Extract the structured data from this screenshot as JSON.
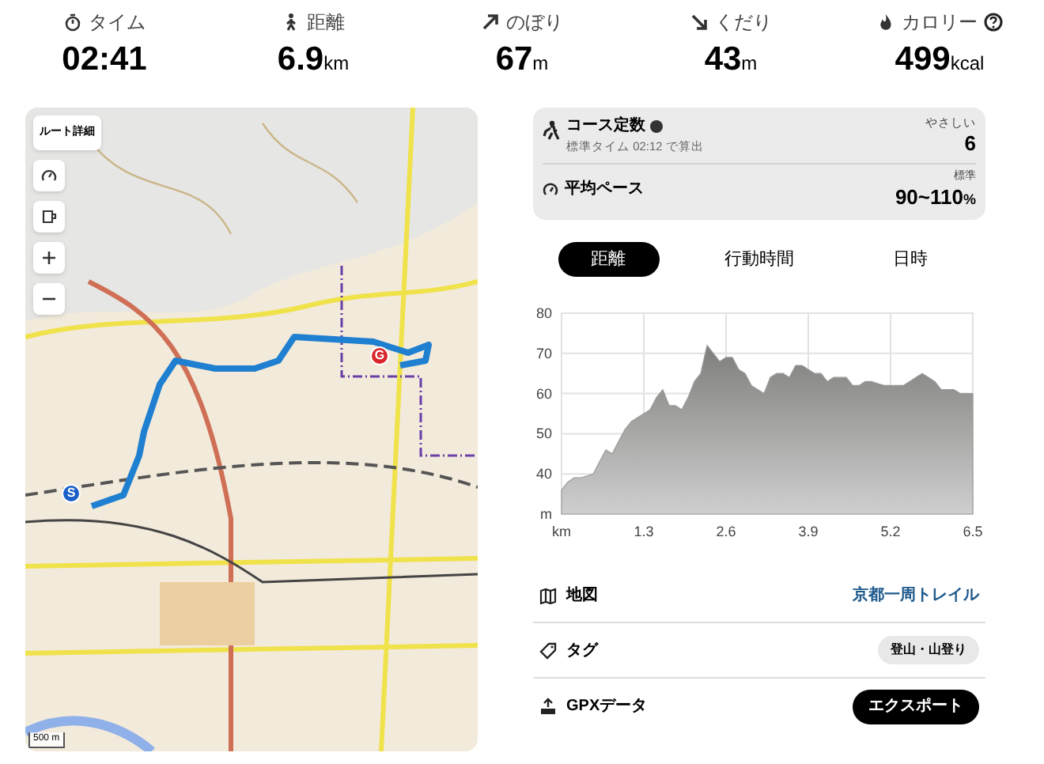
{
  "stats": [
    {
      "kind": "timer",
      "label": "タイム",
      "value": "02:41",
      "help": false
    },
    {
      "kind": "walk",
      "label": "距離",
      "value": "6.9",
      "unit": "km",
      "help": false
    },
    {
      "kind": "up",
      "label": "のぼり",
      "value": "67",
      "unit": "m",
      "help": false
    },
    {
      "kind": "down",
      "label": "くだり",
      "value": "43",
      "unit": "m",
      "help": false
    },
    {
      "kind": "fire",
      "label": "カロリー",
      "value": "499",
      "unit": "kcal",
      "help": true
    }
  ],
  "map": {
    "kind": "picture",
    "route_button": "ルート詳細",
    "scale": "500 m",
    "markers": [
      {
        "label": "S",
        "color": "#1a5fc8"
      },
      {
        "label": "G",
        "color": "#d9262b"
      }
    ]
  },
  "course": {
    "label": "コース定数",
    "sub": "標準タイム 02:12 で算出",
    "rating": "やさしい",
    "value": "6"
  },
  "pace": {
    "label": "平均ペース",
    "rating": "標準",
    "value": "90~110",
    "unit": "%"
  },
  "tabs": [
    {
      "label": "距離",
      "selected": true
    },
    {
      "label": "行動時間",
      "selected": false
    },
    {
      "label": "日時",
      "selected": false
    }
  ],
  "chart_data": {
    "type": "area",
    "grid": true,
    "ylim": [
      30,
      80
    ],
    "xlim": [
      0,
      6.5
    ],
    "yticks": [
      {
        "value": 30,
        "label": "m"
      },
      40,
      50,
      60,
      70,
      80
    ],
    "xticks": [
      {
        "value": 0,
        "label": "km"
      },
      1.3,
      2.6,
      3.9,
      5.2,
      6.5
    ],
    "x": [
      0,
      0.1,
      0.2,
      0.3,
      0.4,
      0.5,
      0.6,
      0.7,
      0.8,
      0.9,
      1,
      1.1,
      1.2,
      1.3,
      1.4,
      1.5,
      1.6,
      1.7,
      1.8,
      1.9,
      2,
      2.1,
      2.2,
      2.3,
      2.4,
      2.5,
      2.6,
      2.7,
      2.8,
      2.9,
      3,
      3.1,
      3.2,
      3.3,
      3.4,
      3.5,
      3.6,
      3.7,
      3.8,
      3.9,
      4,
      4.1,
      4.2,
      4.3,
      4.4,
      4.5,
      4.6,
      4.7,
      4.8,
      4.9,
      5,
      5.1,
      5.2,
      5.3,
      5.4,
      5.5,
      5.6,
      5.7,
      5.8,
      5.9,
      6,
      6.1,
      6.2,
      6.3,
      6.4,
      6.5
    ],
    "series": [
      {
        "color": "#9a9a98",
        "values": [
          36,
          38,
          39,
          39,
          39.5,
          40,
          43,
          46,
          45,
          48,
          51,
          53,
          54,
          55,
          56,
          59,
          61,
          57,
          57,
          56,
          59,
          63,
          65,
          72,
          70,
          68,
          69,
          69,
          66,
          65,
          62,
          61,
          60,
          64,
          65,
          65,
          64,
          67,
          67,
          66,
          65,
          65,
          63,
          64,
          64,
          64,
          62,
          62,
          63,
          63,
          62.5,
          62,
          62,
          62,
          62,
          63,
          64,
          65,
          64,
          63,
          61,
          61,
          61,
          60,
          60,
          60
        ]
      }
    ]
  },
  "info": [
    {
      "kind": "link",
      "label": "地図",
      "value": "京都一周トレイル"
    },
    {
      "kind": "tag",
      "label": "タグ",
      "value": "登山・山登り"
    },
    {
      "kind": "button",
      "label": "GPXデータ",
      "value": "エクスポート"
    }
  ]
}
